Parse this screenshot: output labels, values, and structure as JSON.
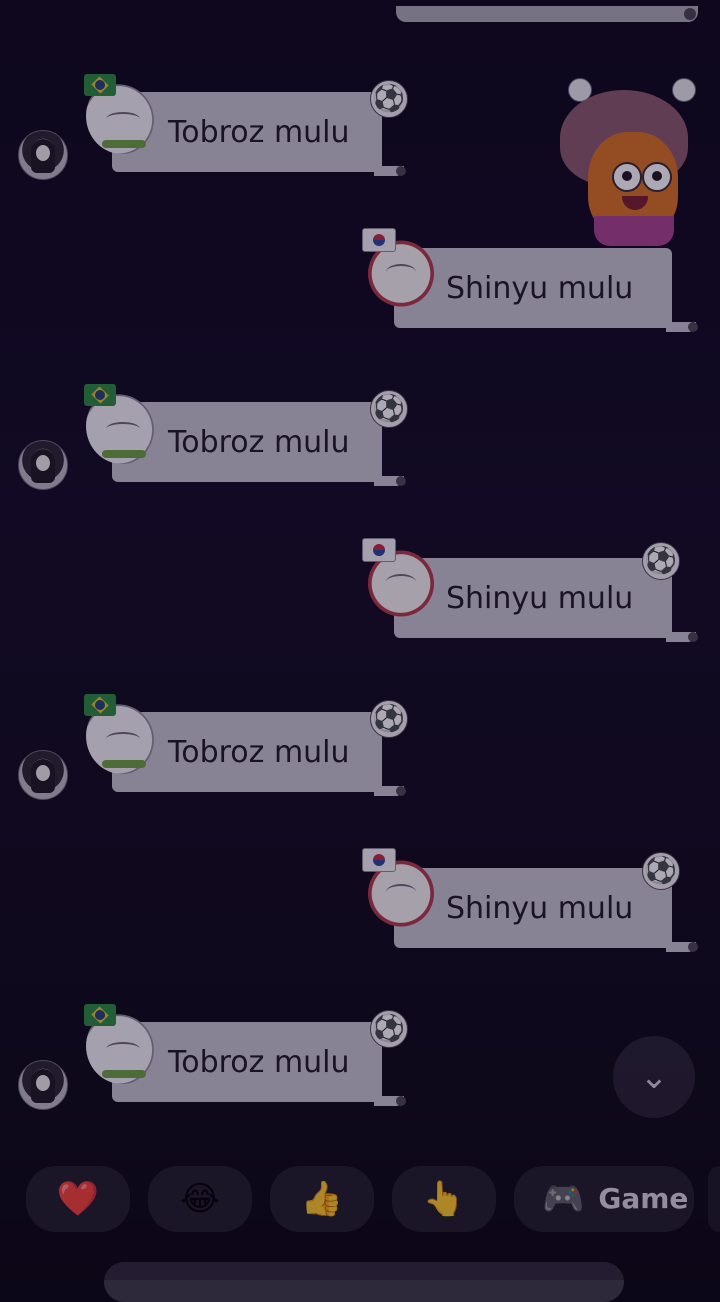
{
  "chat": {
    "messages": [
      {
        "side": "left",
        "text": "Tobroz mulu",
        "sticker": "cat-brazil-flag-sticker",
        "decor": "soccer-ball-icon"
      },
      {
        "side": "right",
        "text": "Shinyu mulu",
        "sticker": "dog-korea-flag-sticker",
        "decor": "mascot-sticker"
      },
      {
        "side": "left",
        "text": "Tobroz mulu",
        "sticker": "cat-brazil-flag-sticker",
        "decor": "soccer-ball-icon"
      },
      {
        "side": "right",
        "text": "Shinyu mulu",
        "sticker": "dog-korea-flag-sticker",
        "decor": "soccer-ball-icon"
      },
      {
        "side": "left",
        "text": "Tobroz mulu",
        "sticker": "cat-brazil-flag-sticker",
        "decor": "soccer-ball-icon"
      },
      {
        "side": "right",
        "text": "Shinyu mulu",
        "sticker": "dog-korea-flag-sticker",
        "decor": "soccer-ball-icon"
      },
      {
        "side": "left",
        "text": "Tobroz mulu",
        "sticker": "cat-brazil-flag-sticker",
        "decor": "soccer-ball-icon"
      }
    ]
  },
  "icons": {
    "ball": "⚽",
    "chevron": "⌄",
    "heart": "❤️",
    "laugh": "😂",
    "thumbs": "👍",
    "point": "👆",
    "gamepad": "🎮"
  },
  "quickbar": {
    "game_label": "Game"
  },
  "colors": {
    "bubble": "#c7c3cf",
    "background": "#0d0a18"
  }
}
